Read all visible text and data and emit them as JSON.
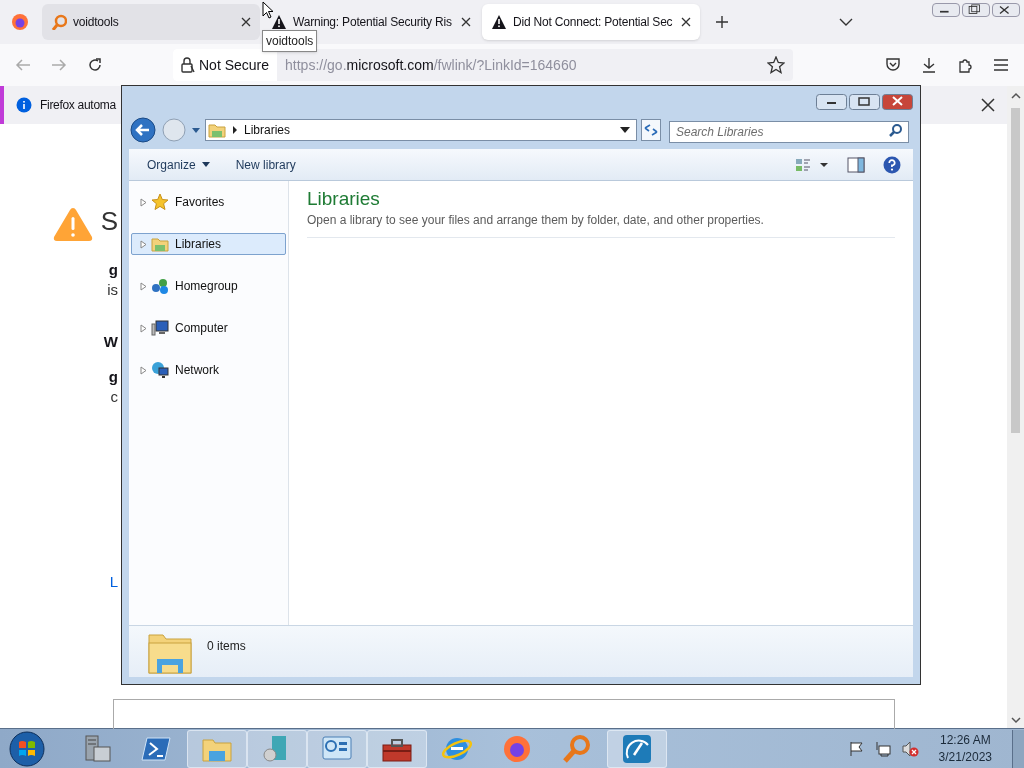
{
  "browser": {
    "tabs": [
      {
        "kind": "voidtools",
        "title": "voidtools",
        "selected": false
      },
      {
        "kind": "warning",
        "title": "Warning: Potential Security Ris",
        "selected": false
      },
      {
        "kind": "warning",
        "title": "Did Not Connect: Potential Sec",
        "selected": true
      }
    ],
    "tooltip": "voidtools",
    "address": {
      "security": "Not Secure",
      "url_start": "https://go.",
      "url_domain": "microsoft.com",
      "url_end": "/fwlink/?LinkId=164660"
    },
    "notification": "Firefox automa",
    "page_fragments": [
      {
        "kind": "heading",
        "text": "S"
      },
      {
        "kind": "bold",
        "text": "g"
      },
      {
        "kind": "plain",
        "text": "is"
      },
      {
        "kind": "bold",
        "text": "W"
      },
      {
        "kind": "bold",
        "text": "g"
      },
      {
        "kind": "plain",
        "text": "c"
      },
      {
        "kind": "link",
        "text": "L"
      }
    ]
  },
  "explorer": {
    "breadcrumb": "Libraries",
    "search": {
      "placeholder": "Search Libraries"
    },
    "toolbar": [
      {
        "label": "Organize",
        "dropdown": true
      },
      {
        "label": "New library",
        "dropdown": false
      }
    ],
    "nav": [
      {
        "kind": "star",
        "label": "Favorites",
        "selected": false
      },
      {
        "kind": "library",
        "label": "Libraries",
        "selected": true
      },
      {
        "kind": "homegroup",
        "label": "Homegroup",
        "selected": false
      },
      {
        "kind": "computer",
        "label": "Computer",
        "selected": false
      },
      {
        "kind": "network",
        "label": "Network",
        "selected": false
      }
    ],
    "heading": "Libraries",
    "description": "Open a library to see your files and arrange them by folder, date, and other properties.",
    "status": "0 items"
  },
  "taskbar": {
    "items": [
      {
        "kind": "server",
        "running": false
      },
      {
        "kind": "powershell",
        "running": false
      },
      {
        "kind": "explorer",
        "running": true
      },
      {
        "kind": "tools",
        "running": true
      },
      {
        "kind": "panel",
        "running": true
      },
      {
        "kind": "toolbox",
        "running": true
      },
      {
        "kind": "ie",
        "running": false
      },
      {
        "kind": "firefox",
        "running": false
      },
      {
        "kind": "search",
        "running": false
      },
      {
        "kind": "gauge",
        "running": true
      }
    ],
    "time": "12:26 AM",
    "date": "3/21/2023"
  }
}
